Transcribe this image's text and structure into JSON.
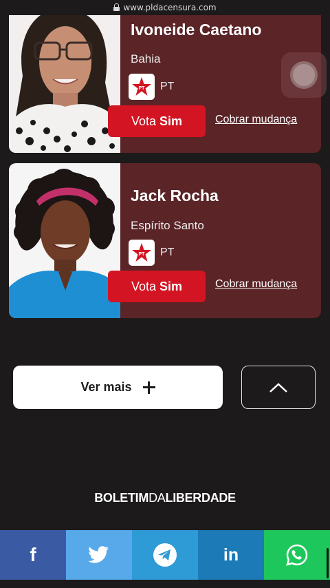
{
  "browser": {
    "url": "www.pldacensura.com"
  },
  "cards": [
    {
      "name": "Ivoneide Caetano",
      "state": "Bahia",
      "party": "PT",
      "vote_prefix": "Vota",
      "vote_bold": "Sim",
      "cobrar": "Cobrar mudança"
    },
    {
      "name": "Jack Rocha",
      "state": "Espírito Santo",
      "party": "PT",
      "vote_prefix": "Vota",
      "vote_bold": "Sim",
      "cobrar": "Cobrar mudança"
    }
  ],
  "buttons": {
    "ver_mais": "Ver mais"
  },
  "footer": {
    "brand_a": "BOLETIM",
    "brand_b": "DA",
    "brand_c": "LIBERDADE"
  },
  "share": [
    "facebook-icon",
    "twitter-icon",
    "telegram-icon",
    "linkedin-icon",
    "whatsapp-icon"
  ],
  "colors": {
    "card_bg": "#5b2427",
    "vote_red": "#d31422",
    "page_bg": "#1c1a1b"
  }
}
